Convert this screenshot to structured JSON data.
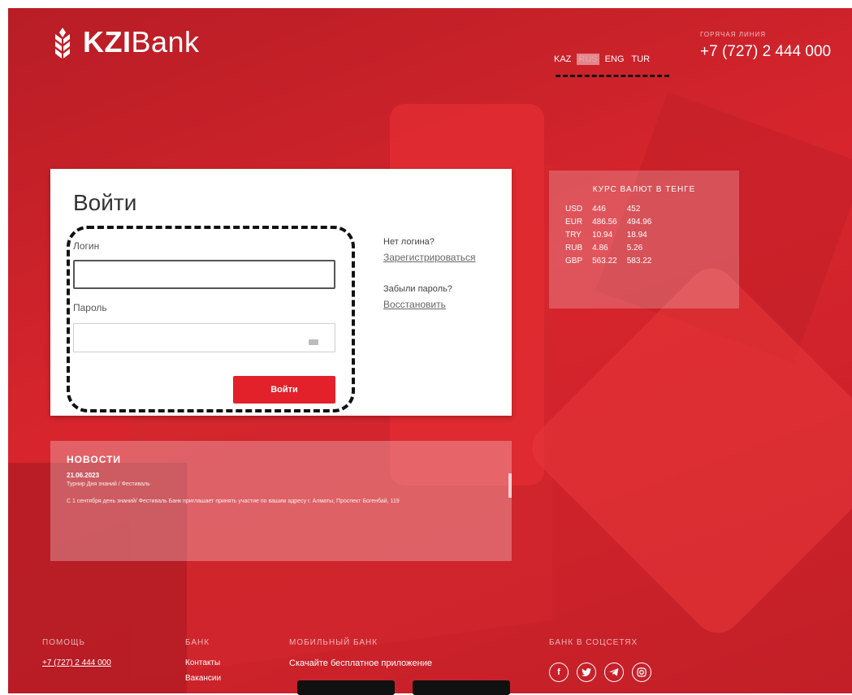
{
  "brand": {
    "name_bold": "KZI",
    "name_regular": "Bank"
  },
  "header": {
    "languages": [
      "KAZ",
      "RUS",
      "ENG",
      "TUR"
    ],
    "active_language": "RUS",
    "hotline_label": "ГОРЯЧАЯ ЛИНИЯ",
    "hotline_phone": "+7 (727) 2 444 000"
  },
  "login": {
    "title": "Войти",
    "login_label": "Логин",
    "login_value": "",
    "password_label": "Пароль",
    "password_value": "",
    "submit_label": "Войти",
    "no_login_question": "Нет логина?",
    "register_link": "Зарегистрироваться",
    "forgot_question": "Забыли пароль?",
    "restore_link": "Восстановить"
  },
  "rates": {
    "title": "КУРС ВАЛЮТ В ТЕНГЕ",
    "rows": [
      {
        "currency": "USD",
        "buy": "446",
        "sell": "452"
      },
      {
        "currency": "EUR",
        "buy": "486.56",
        "sell": "494.96"
      },
      {
        "currency": "TRY",
        "buy": "10.94",
        "sell": "18.94"
      },
      {
        "currency": "RUB",
        "buy": "4.86",
        "sell": "5.26"
      },
      {
        "currency": "GBP",
        "buy": "563.22",
        "sell": "583.22"
      }
    ]
  },
  "news": {
    "title": "НОВОСТИ",
    "date": "21.06.2023",
    "headline": "Турнир Дня знаний / Фестиваль",
    "body": "С 1 сентября день знаний/ Фестиваль Банк приглашает принять участие по вашим адресу г. Алматы, Проспект Богенбай, 119"
  },
  "footer": {
    "help": {
      "heading": "ПОМОЩЬ",
      "phone": "+7 (727) 2 444 000"
    },
    "bank": {
      "heading": "БАНК",
      "item1": "Контакты",
      "item2": "Вакансии"
    },
    "mobile": {
      "heading": "МОБИЛЬНЫЙ БАНК",
      "text": "Скачайте бесплатное приложение"
    },
    "social": {
      "heading": "БАНК В СОЦСЕТЯХ",
      "icons": [
        "facebook-icon",
        "twitter-icon",
        "telegram-icon",
        "instagram-icon"
      ]
    }
  },
  "colors": {
    "accent": "#e3212b",
    "background": "#c8232c"
  }
}
